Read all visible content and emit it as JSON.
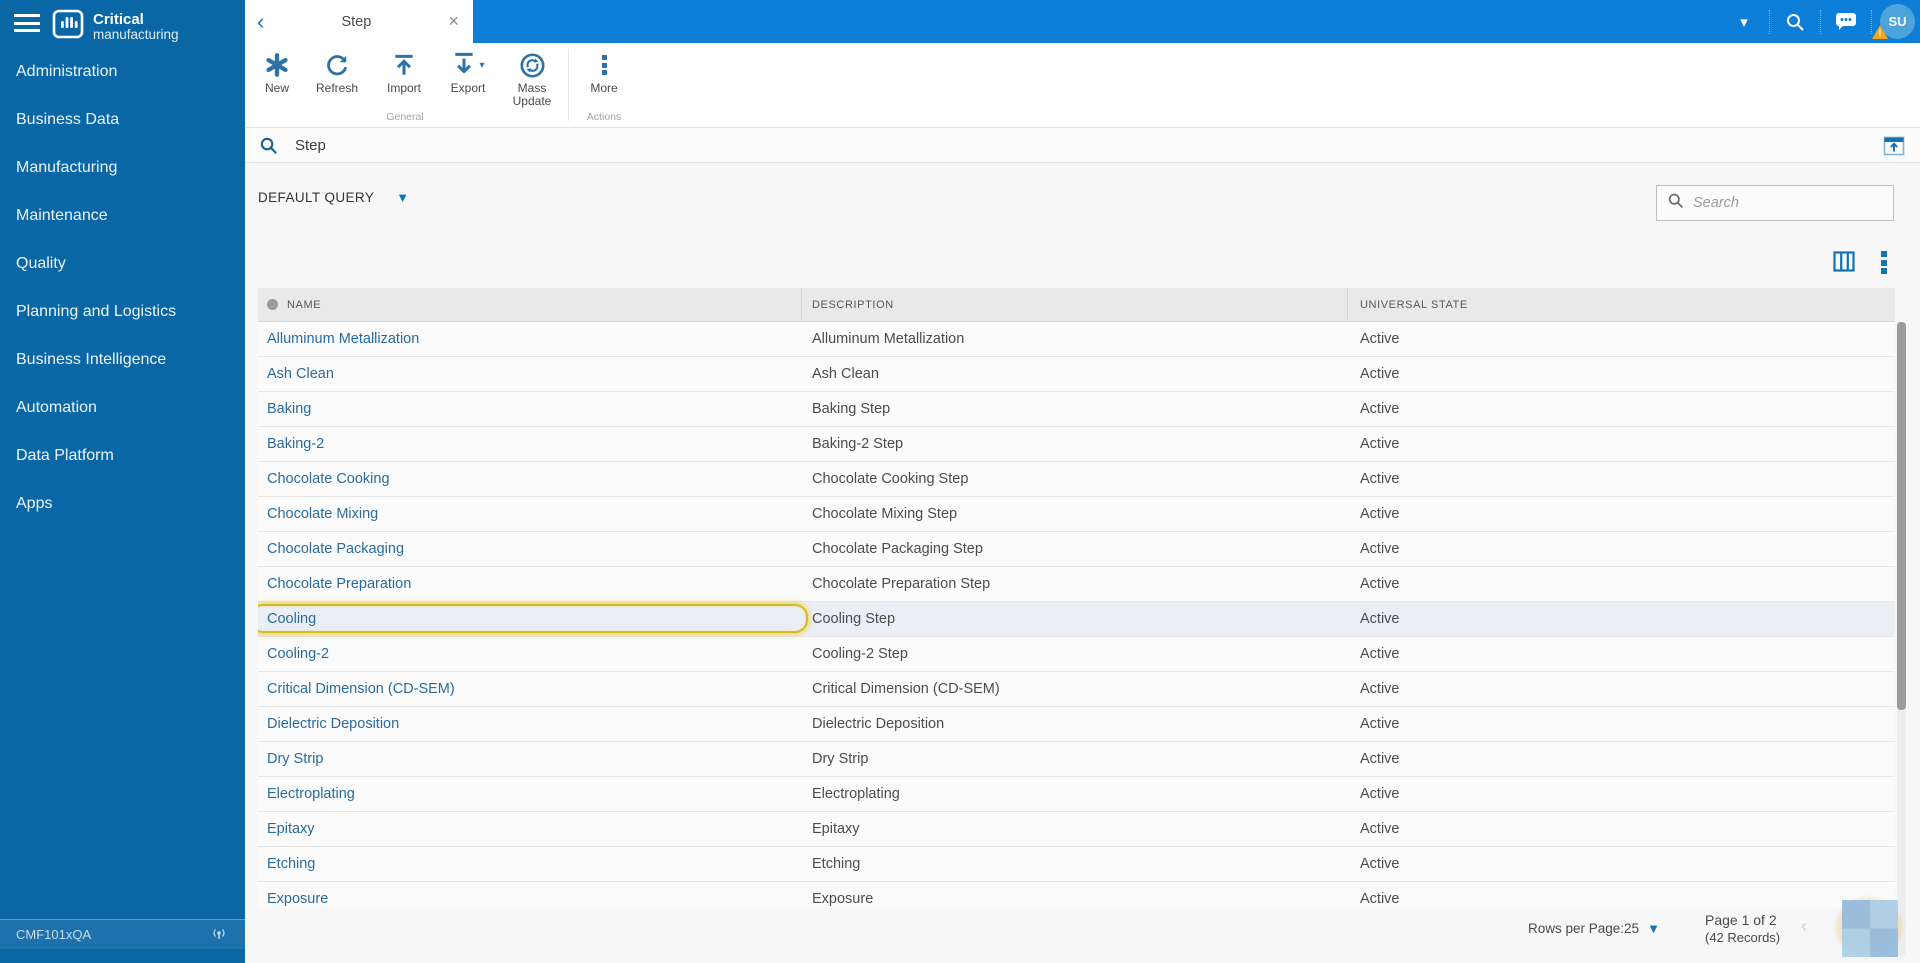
{
  "sidebar": {
    "brand": {
      "line1": "Critical",
      "line2": "manufacturing"
    },
    "items": [
      {
        "label": "Administration"
      },
      {
        "label": "Business Data"
      },
      {
        "label": "Manufacturing"
      },
      {
        "label": "Maintenance"
      },
      {
        "label": "Quality"
      },
      {
        "label": "Planning and Logistics"
      },
      {
        "label": "Business Intelligence"
      },
      {
        "label": "Automation"
      },
      {
        "label": "Data Platform"
      },
      {
        "label": "Apps"
      }
    ],
    "status": {
      "environment": "CMF101xQA"
    }
  },
  "topbar": {
    "tab": {
      "title": "Step",
      "back_glyph": "‹",
      "close_glyph": "×"
    },
    "user_initials": "SU",
    "warning_glyph": "!"
  },
  "toolbar": {
    "buttons": [
      {
        "label": "New"
      },
      {
        "label": "Refresh"
      },
      {
        "label": "Import"
      },
      {
        "label": "Export"
      },
      {
        "label": "Mass Update"
      },
      {
        "label": "More"
      }
    ],
    "groups": [
      {
        "label": "General"
      },
      {
        "label": "Actions"
      }
    ]
  },
  "search_bar": {
    "value": "Step"
  },
  "query": {
    "selected": "DEFAULT QUERY"
  },
  "grid_search": {
    "placeholder": "Search"
  },
  "table": {
    "columns": {
      "name": "NAME",
      "description": "DESCRIPTION",
      "state": "UNIVERSAL STATE"
    },
    "highlighted_row": "Cooling",
    "rows": [
      {
        "name": "Alluminum Metallization",
        "description": "Alluminum Metallization",
        "state": "Active"
      },
      {
        "name": "Ash Clean",
        "description": "Ash Clean",
        "state": "Active"
      },
      {
        "name": "Baking",
        "description": "Baking Step",
        "state": "Active"
      },
      {
        "name": "Baking-2",
        "description": "Baking-2 Step",
        "state": "Active"
      },
      {
        "name": "Chocolate Cooking",
        "description": "Chocolate Cooking Step",
        "state": "Active"
      },
      {
        "name": "Chocolate Mixing",
        "description": "Chocolate Mixing Step",
        "state": "Active"
      },
      {
        "name": "Chocolate Packaging",
        "description": "Chocolate Packaging Step",
        "state": "Active"
      },
      {
        "name": "Chocolate Preparation",
        "description": "Chocolate Preparation Step",
        "state": "Active"
      },
      {
        "name": "Cooling",
        "description": "Cooling Step",
        "state": "Active"
      },
      {
        "name": "Cooling-2",
        "description": "Cooling-2 Step",
        "state": "Active"
      },
      {
        "name": "Critical Dimension (CD-SEM)",
        "description": "Critical Dimension (CD-SEM)",
        "state": "Active"
      },
      {
        "name": "Dielectric Deposition",
        "description": "Dielectric Deposition",
        "state": "Active"
      },
      {
        "name": "Dry Strip",
        "description": "Dry Strip",
        "state": "Active"
      },
      {
        "name": "Electroplating",
        "description": "Electroplating",
        "state": "Active"
      },
      {
        "name": "Epitaxy",
        "description": "Epitaxy",
        "state": "Active"
      },
      {
        "name": "Etching",
        "description": "Etching",
        "state": "Active"
      },
      {
        "name": "Exposure",
        "description": "Exposure",
        "state": "Active"
      }
    ]
  },
  "footer": {
    "rows_per_page_label": "Rows per Page:25",
    "page_info": "Page 1 of 2",
    "records_info": "(42 Records)",
    "prev_glyph": "‹"
  },
  "colors": {
    "topbar_blue": "#0d7ed7",
    "sidebar_blue": "#0a67a6",
    "link_blue": "#2a6b9f",
    "toolbar_icon_blue": "#2e73a7",
    "accent_icon_blue": "#1273b4",
    "highlight_ring": "#dcb822",
    "highlight_row_bg": "#e9eff4",
    "warning_orange": "#f0a71d"
  }
}
